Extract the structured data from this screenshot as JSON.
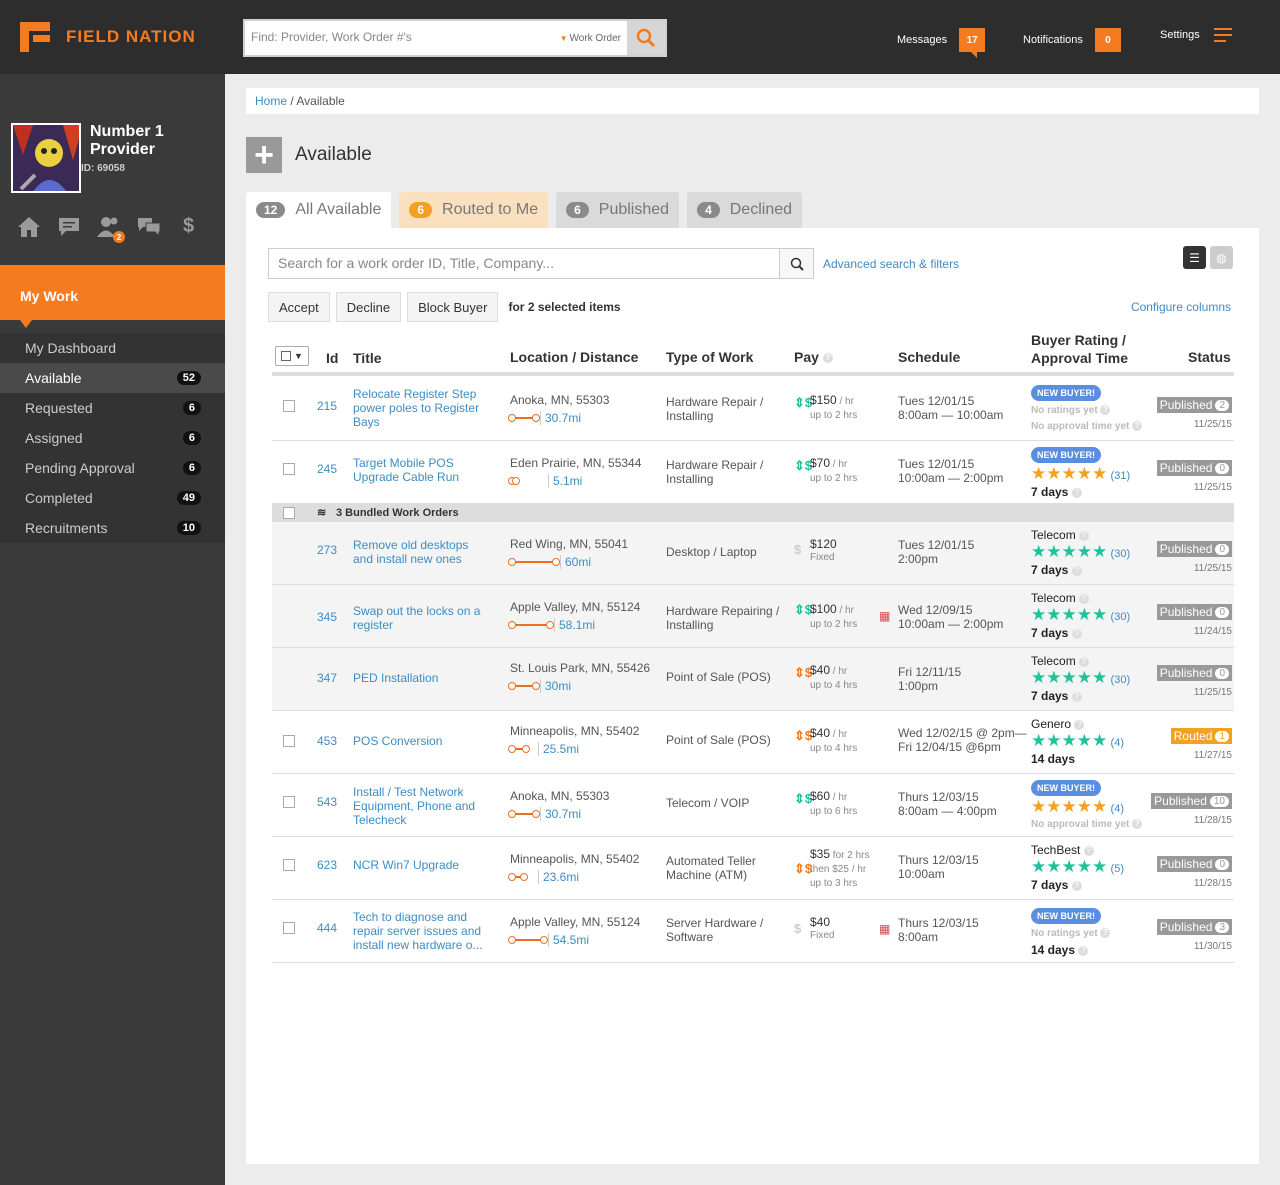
{
  "app": {
    "brand": "FIELD NATION",
    "brand_color": "#f47b20"
  },
  "header": {
    "search_placeholder": "Find: Provider, Work Order #'s",
    "search_scope": "Work Order",
    "messages_label": "Messages",
    "messages_count": "17",
    "notifications_label": "Notifications",
    "notifications_count": "0",
    "settings_label": "Settings"
  },
  "profile": {
    "name_line1": "Number 1",
    "name_line2": "Provider",
    "id": "ID: 69058",
    "people_badge": "2"
  },
  "sidebar": {
    "section": "My Work",
    "items": [
      {
        "label": "My Dashboard",
        "count": ""
      },
      {
        "label": "Available",
        "count": "52"
      },
      {
        "label": "Requested",
        "count": "6"
      },
      {
        "label": "Assigned",
        "count": "6"
      },
      {
        "label": "Pending Approval",
        "count": "6"
      },
      {
        "label": "Completed",
        "count": "49"
      },
      {
        "label": "Recruitments",
        "count": "10"
      }
    ]
  },
  "breadcrumb": {
    "home": "Home",
    "sep": " / ",
    "current": "Available"
  },
  "page": {
    "title": "Available"
  },
  "tabs": [
    {
      "count": "12",
      "label": "All Available"
    },
    {
      "count": "6",
      "label": "Routed to Me"
    },
    {
      "count": "6",
      "label": "Published"
    },
    {
      "count": "4",
      "label": "Declined"
    }
  ],
  "toolbar": {
    "search_placeholder": "Search for a work order ID, Title, Company...",
    "advanced": "Advanced search & filters",
    "accept": "Accept",
    "decline": "Decline",
    "block": "Block Buyer",
    "selection_note": "for 2 selected items",
    "configure": "Configure columns"
  },
  "columns": {
    "id": "Id",
    "title": "Title",
    "location": "Location / Distance",
    "type": "Type of Work",
    "pay": "Pay",
    "schedule": "Schedule",
    "rating_l1": "Buyer Rating /",
    "rating_l2": "Approval Time",
    "status": "Status"
  },
  "bundle_label": "3 Bundled Work Orders",
  "rows": [
    {
      "id": "215",
      "title": "Relocate Register Step power poles to Register Bays",
      "loc": "Anoka, MN, 55303",
      "dist": "30.7mi",
      "type": "Hardware Repair / Installing",
      "pay": "$150",
      "unit": " / hr",
      "pay2": "up to 2 hrs",
      "pay3": "",
      "sched1": "Tues 12/01/15",
      "sched2": "8:00am — 10:00am",
      "buyer": "",
      "newbuyer": "NEW BUYER!",
      "r1": "No ratings yet",
      "stars": "",
      "rc": "",
      "days": "",
      "r2": "No approval time yet",
      "status": "Published",
      "scount": "2",
      "sdate": "11/25/15"
    },
    {
      "id": "245",
      "title": "Target Mobile POS Upgrade Cable Run",
      "loc": "Eden Prairie, MN, 55344",
      "dist": "5.1mi",
      "type": "Hardware Repair / Installing",
      "pay": "$70",
      "unit": " / hr",
      "pay2": "up to 2 hrs",
      "pay3": "",
      "sched1": "Tues 12/01/15",
      "sched2": "10:00am — 2:00pm",
      "buyer": "",
      "newbuyer": "NEW BUYER!",
      "r1": "",
      "stars": "★★★★★",
      "rc": "(31)",
      "days": "7 days",
      "r2": "",
      "status": "Published",
      "scount": "0",
      "sdate": "11/25/15"
    },
    {
      "id": "273",
      "title": "Remove old desktops and install new ones",
      "loc": "Red Wing, MN, 55041",
      "dist": "60mi",
      "type": "Desktop / Laptop",
      "pay": "$120",
      "unit": "",
      "pay2": "Fixed",
      "pay3": "",
      "sched1": "Tues 12/01/15",
      "sched2": "2:00pm",
      "buyer": "Telecom",
      "newbuyer": "",
      "r1": "",
      "stars": "★★★★★",
      "rc": "(30)",
      "days": "7 days",
      "r2": "",
      "status": "Published",
      "scount": "0",
      "sdate": "11/25/15"
    },
    {
      "id": "345",
      "title": "Swap out the locks on a register",
      "loc": "Apple Valley, MN, 55124",
      "dist": "58.1mi",
      "type": "Hardware Repairing / Installing",
      "pay": "$100",
      "unit": " / hr",
      "pay2": "up to 2 hrs",
      "pay3": "",
      "sched1": "Wed 12/09/15",
      "sched2": "10:00am — 2:00pm",
      "buyer": "Telecom",
      "newbuyer": "",
      "r1": "",
      "stars": "★★★★★",
      "rc": "(30)",
      "days": "7 days",
      "r2": "",
      "status": "Published",
      "scount": "0",
      "sdate": "11/24/15"
    },
    {
      "id": "347",
      "title": "PED Installation",
      "loc": "St. Louis Park, MN, 55426",
      "dist": "30mi",
      "type": "Point of Sale (POS)",
      "pay": "$40",
      "unit": " / hr",
      "pay2": "up to 4 hrs",
      "pay3": "",
      "sched1": "Fri 12/11/15",
      "sched2": "1:00pm",
      "buyer": "Telecom",
      "newbuyer": "",
      "r1": "",
      "stars": "★★★★★",
      "rc": "(30)",
      "days": "7 days",
      "r2": "",
      "status": "Published",
      "scount": "0",
      "sdate": "11/25/15"
    },
    {
      "id": "453",
      "title": "POS Conversion",
      "loc": "Minneapolis, MN, 55402",
      "dist": "25.5mi",
      "type": "Point of Sale (POS)",
      "pay": "$40",
      "unit": " / hr",
      "pay2": "up to 4 hrs",
      "pay3": "",
      "sched1": "Wed 12/02/15 @ 2pm—",
      "sched2": "Fri 12/04/15 @6pm",
      "buyer": "Genero",
      "newbuyer": "",
      "r1": "",
      "stars": "★★★★★",
      "rc": "(4)",
      "days": "14 days",
      "r2": "",
      "status": "Routed",
      "scount": "1",
      "sdate": "11/27/15"
    },
    {
      "id": "543",
      "title": "Install / Test Network Equipment, Phone and Telecheck",
      "loc": "Anoka, MN, 55303",
      "dist": "30.7mi",
      "type": "Telecom / VOIP",
      "pay": "$60",
      "unit": " / hr",
      "pay2": "up to 6 hrs",
      "pay3": "",
      "sched1": "Thurs 12/03/15",
      "sched2": "8:00am — 4:00pm",
      "buyer": "",
      "newbuyer": "NEW BUYER!",
      "r1": "",
      "stars": "★★★★★",
      "rc": "(4)",
      "days": "",
      "r2": "No approval time yet",
      "status": "Published",
      "scount": "10",
      "sdate": "11/28/15"
    },
    {
      "id": "623",
      "title": "NCR Win7 Upgrade",
      "loc": "Minneapolis, MN, 55402",
      "dist": "23.6mi",
      "type": "Automated Teller Machine (ATM)",
      "pay": "$35",
      "unit": " for 2 hrs",
      "pay2": "then $25 / hr",
      "pay3": "up to 3 hrs",
      "sched1": "Thurs 12/03/15",
      "sched2": "10:00am",
      "buyer": "TechBest",
      "newbuyer": "",
      "r1": "",
      "stars": "★★★★★",
      "rc": "(5)",
      "days": "7 days",
      "r2": "",
      "status": "Published",
      "scount": "0",
      "sdate": "11/28/15"
    },
    {
      "id": "444",
      "title": "Tech to diagnose and repair server issues and install new hardware o...",
      "loc": "Apple Valley, MN, 55124",
      "dist": "54.5mi",
      "type": "Server Hardware / Software",
      "pay": "$40",
      "unit": "",
      "pay2": "Fixed",
      "pay3": "",
      "sched1": "Thurs 12/03/15",
      "sched2": "8:00am",
      "buyer": "",
      "newbuyer": "NEW BUYER!",
      "r1": "No ratings yet",
      "stars": "",
      "rc": "",
      "days": "14 days",
      "r2": "",
      "status": "Published",
      "scount": "3",
      "sdate": "11/30/15"
    }
  ]
}
